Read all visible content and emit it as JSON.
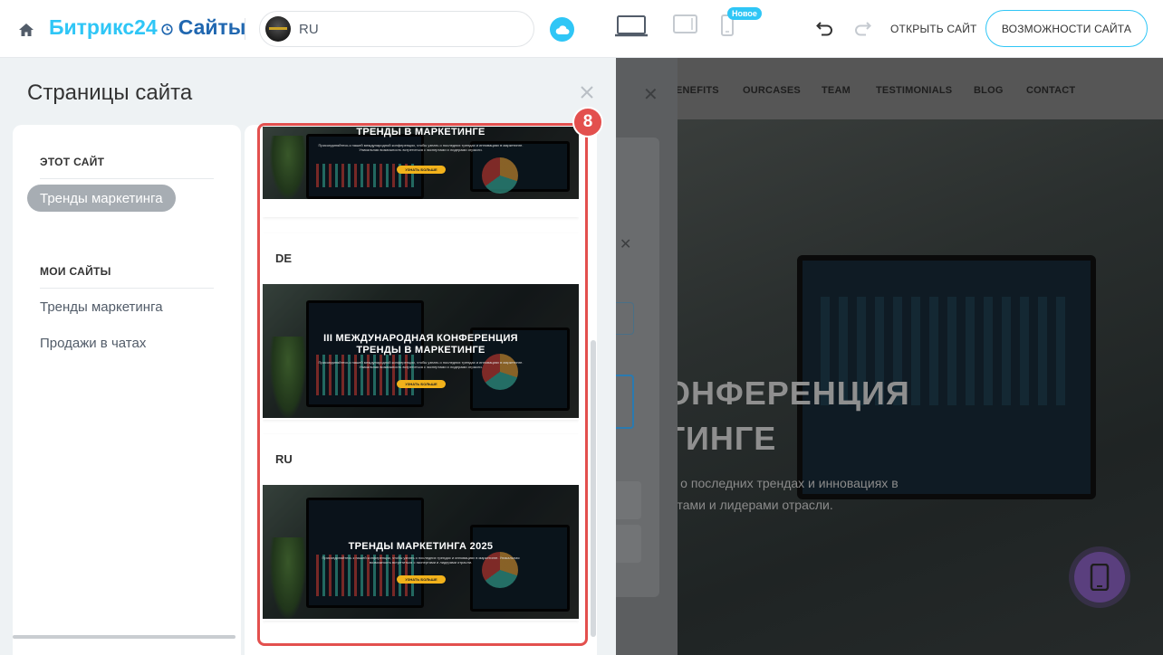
{
  "topbar": {
    "logo_main": "Битрикс24",
    "logo_sites": "Сайты",
    "language": {
      "value": "RU"
    },
    "new_badge": "Новое",
    "open_site_label": "ОТКРЫТЬ САЙТ",
    "features_label": "ВОЗМОЖНОСТИ САЙТА",
    "accent_color": "#2fc6f6"
  },
  "slider": {
    "title": "Страницы сайта",
    "this_site": {
      "heading": "ЭТОТ САЙТ",
      "active_item": "Тренды маркетинга"
    },
    "my_sites": {
      "heading": "МОИ САЙТЫ",
      "items": [
        {
          "label": "Тренды маркетинга"
        },
        {
          "label": "Продажи в чатах"
        }
      ]
    },
    "step_badge": "8",
    "pages": [
      {
        "label": "",
        "thumb_title": "ТРЕНДЫ В МАРКЕТИНГЕ",
        "thumb_subtitle": "Присоединяйтесь к нашей международной конференции, чтобы узнать о последних трендах и инновациях в маркетинге. Уникальная возможность встретиться с экспертами и лидерами отрасли.",
        "thumb_button": "УЗНАТЬ БОЛЬШЕ"
      },
      {
        "label": "DE",
        "thumb_title": "III МЕЖДУНАРОДНАЯ КОНФЕРЕНЦИЯ\nТРЕНДЫ В МАРКЕТИНГЕ",
        "thumb_subtitle": "Присоединяйтесь к нашей международной конференции, чтобы узнать о последних трендах и инновациях в маркетинге. Уникальная возможность встретиться с экспертами и лидерами отрасли.",
        "thumb_button": "УЗНАТЬ БОЛЬШЕ"
      },
      {
        "label": "RU",
        "thumb_title": "ТРЕНДЫ МАРКЕТИНГА 2025",
        "thumb_subtitle": "Присоединяйтесь к нашей конференции, чтобы узнать о последних трендах и инновациях в маркетинге. Уникальная возможность встретиться с экспертами и лидерами отрасли.",
        "thumb_button": "УЗНАТЬ БОЛЬШЕ"
      }
    ],
    "highlight_color": "#e3504e"
  },
  "preview": {
    "nav": [
      "ENEFITS",
      "OURCASES",
      "TEAM",
      "TESTIMONIALS",
      "BLOG",
      "CONTACT"
    ],
    "hero_line_1": "ОНФЕРЕНЦИЯ",
    "hero_line_2": "ТИНГЕ",
    "text_line_1": "ь о последних трендах и инновациях в",
    "text_line_2": "ртами и лидерами отрасли."
  }
}
